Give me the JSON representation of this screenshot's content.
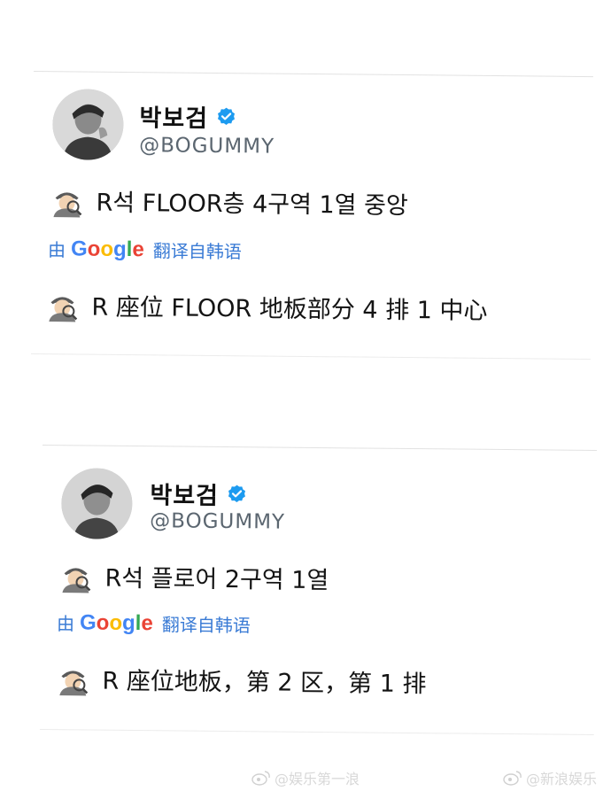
{
  "colors": {
    "link_blue": "#3a7bd5",
    "verified_blue": "#1d9bf0",
    "handle_gray": "#5b6670",
    "watermark_gray": "#d8d8d8"
  },
  "tweets": [
    {
      "display_name": "박보검",
      "handle": "@BOGUMMY",
      "avatar_icon": "user-avatar",
      "emoji_icon": "detective-emoji",
      "original_text": "R석 FLOOR층 4구역 1열 중앙",
      "translate": {
        "by": "由",
        "brand": "Google",
        "label": "翻译自韩语"
      },
      "translated_text": "R 座位 FLOOR 地板部分 4 排 1 中心"
    },
    {
      "display_name": "박보검",
      "handle": "@BOGUMMY",
      "avatar_icon": "user-avatar",
      "emoji_icon": "detective-emoji",
      "original_text": "R석 플로어 2구역 1열",
      "translate": {
        "by": "由",
        "brand": "Google",
        "label": "翻译自韩语"
      },
      "translated_text": "R 座位地板，第 2 区，第 1 排"
    }
  ],
  "watermarks": [
    {
      "icon": "weibo-icon",
      "text": "@娱乐第一浪"
    },
    {
      "icon": "weibo-icon",
      "text": "@新浪娱乐"
    }
  ]
}
